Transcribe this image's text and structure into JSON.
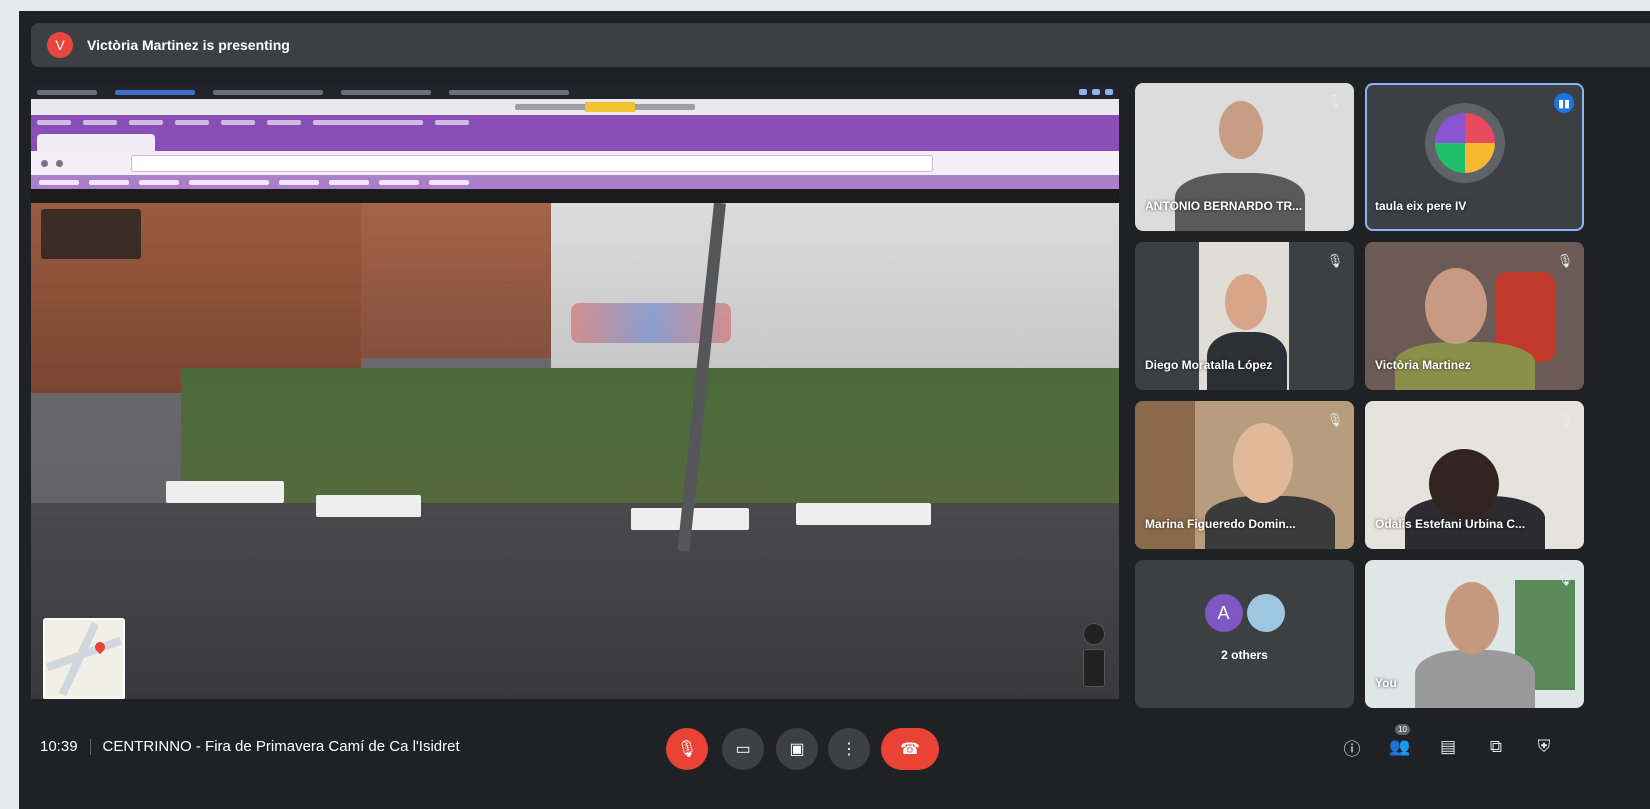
{
  "banner": {
    "avatar_letter": "V",
    "text": "Victòria Martinez is presenting"
  },
  "participants": [
    {
      "name": "ANTONIO BERNARDO TR...",
      "muted": true
    },
    {
      "name": "taula eix pere IV",
      "speaking": true
    },
    {
      "name": "Diego Moratalla López",
      "muted": true
    },
    {
      "name": "Victòria Martinez",
      "muted": true
    },
    {
      "name": "Marina Figueredo Domin...",
      "muted": true
    },
    {
      "name": "Odalis Estefani Urbina C...",
      "muted": true
    },
    {
      "name": "You",
      "muted": true
    }
  ],
  "others": {
    "avatar_letter": "A",
    "label": "2 others"
  },
  "meeting": {
    "time": "10:39",
    "title": "CENTRINNO - Fira de Primavera Camí de Ca l'Isidret"
  },
  "controls": {
    "mic": "mic-off-icon",
    "camera": "camera-icon",
    "present": "present-icon",
    "more": "more-icon",
    "leave": "leave-call-icon"
  },
  "right_controls": {
    "people_count": "10"
  },
  "colors": {
    "accent": "#8ab4f8",
    "leave": "#ea4335",
    "background": "#202124",
    "tile": "#3c4043"
  }
}
